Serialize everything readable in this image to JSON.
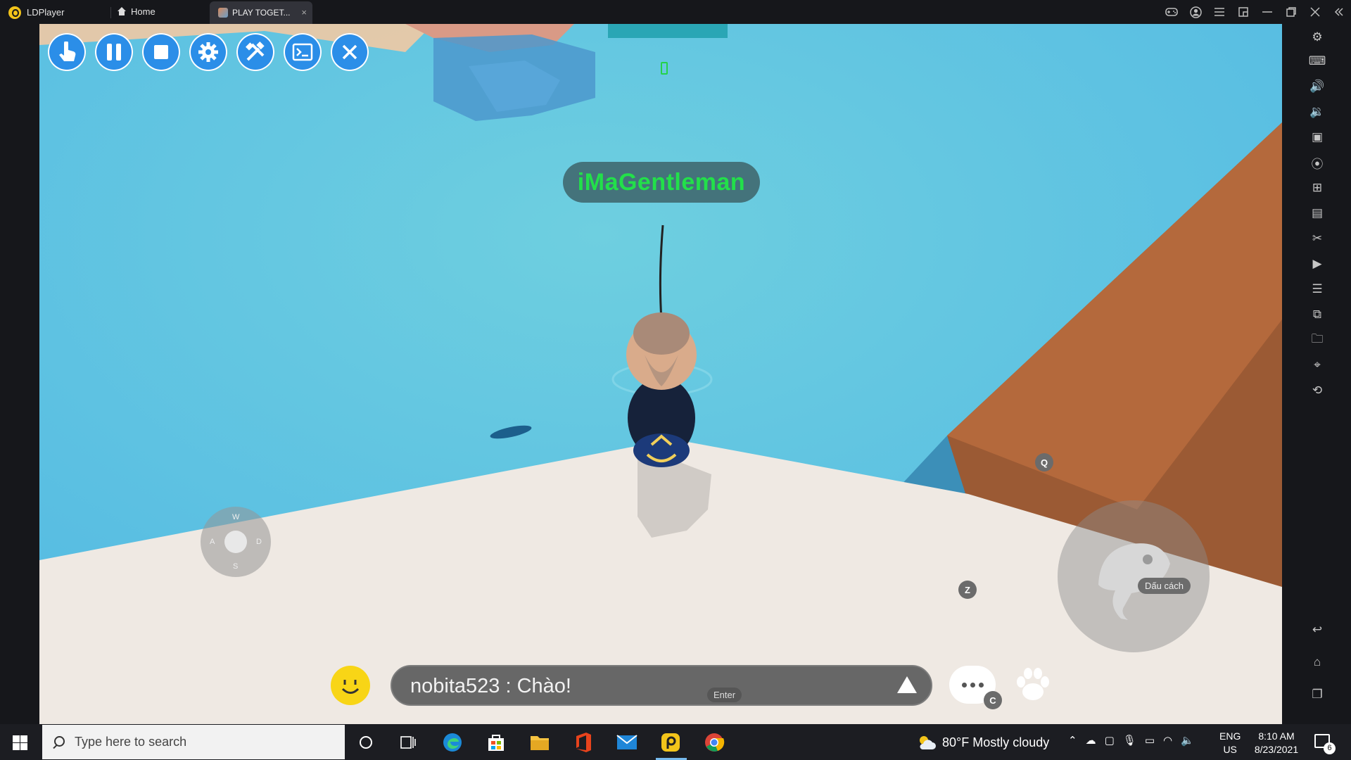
{
  "titlebar": {
    "app_name": "LDPlayer",
    "tabs": [
      {
        "label": "Home"
      },
      {
        "label": "PLAY TOGET...",
        "close": "×"
      }
    ]
  },
  "game": {
    "player_name": "iMaGentleman",
    "joystick": {
      "up": "W",
      "left": "A",
      "right": "D",
      "down": "S"
    },
    "hints": {
      "q": "Q",
      "z": "Z",
      "c": "C",
      "enter": "Enter"
    },
    "action_label": "Dấu cách",
    "chat_text": "nobita523 : Chào!"
  },
  "taskbar": {
    "search_placeholder": "Type here to search",
    "weather": "80°F  Mostly cloudy",
    "lang_line1": "ENG",
    "lang_line2": "US",
    "time": "8:10 AM",
    "date": "8/23/2021",
    "notification_count": "6"
  }
}
